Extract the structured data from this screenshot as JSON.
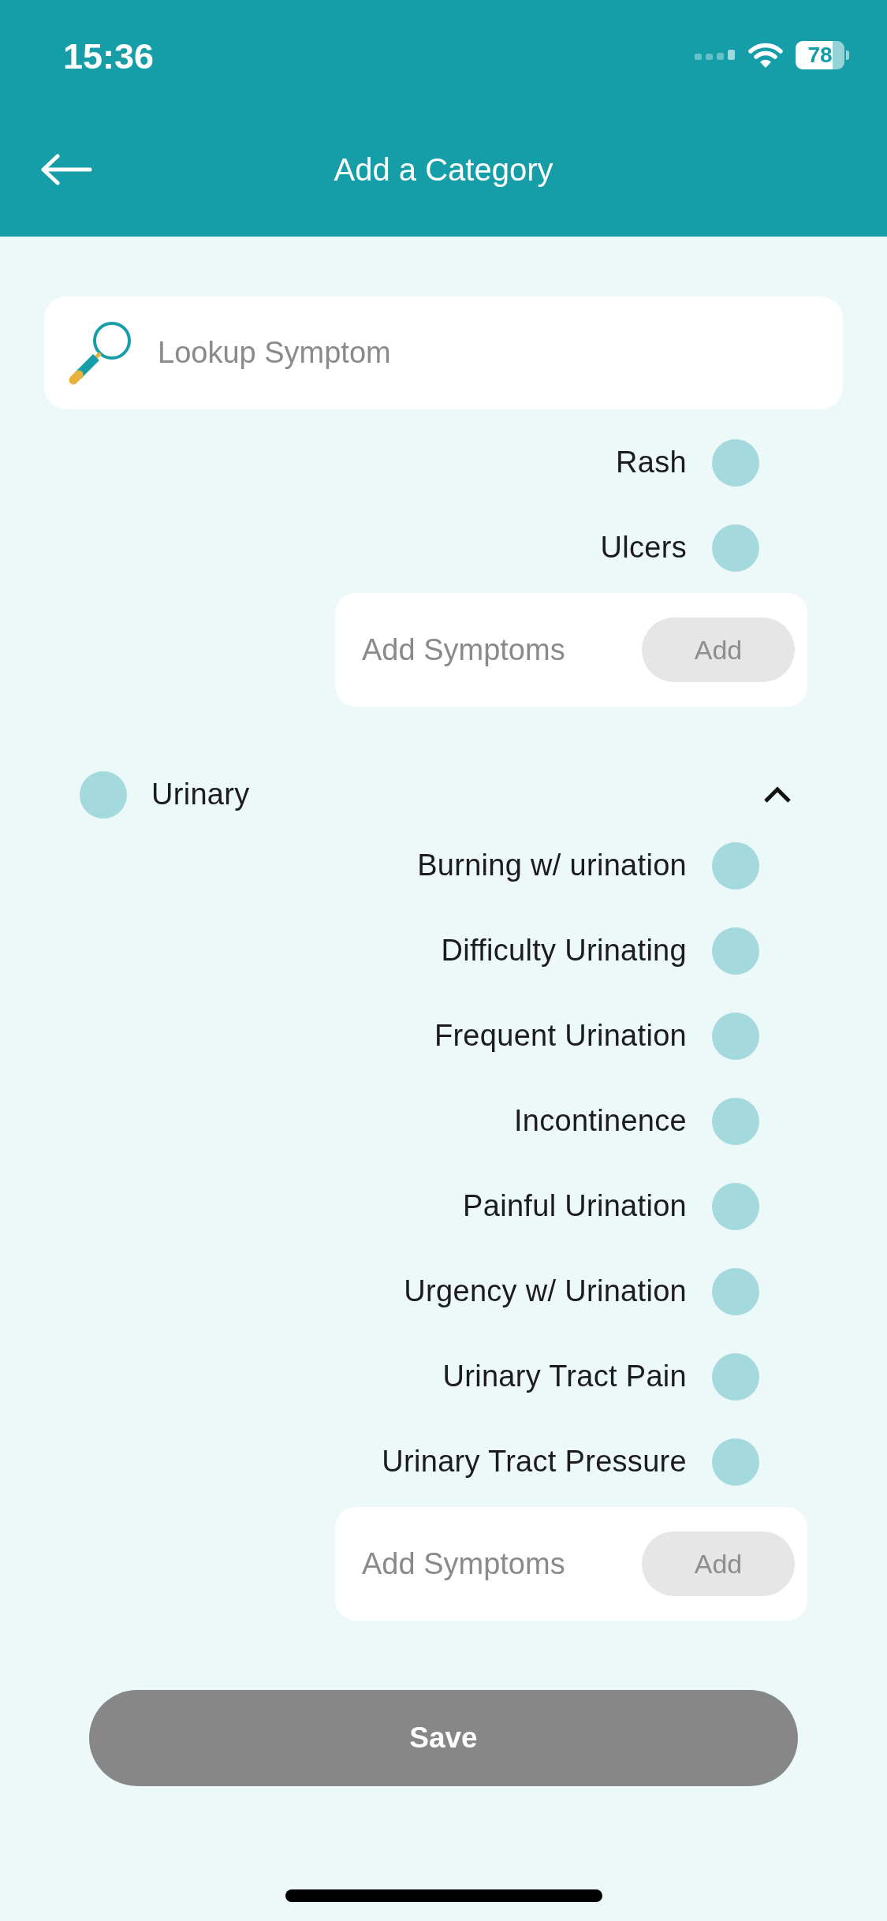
{
  "status_bar": {
    "time": "15:36",
    "battery": "78"
  },
  "header": {
    "title": "Add a Category"
  },
  "search": {
    "placeholder": "Lookup Symptom"
  },
  "categories": [
    {
      "symptoms": [
        {
          "name": "Rash",
          "selected": false
        },
        {
          "name": "Ulcers",
          "selected": false
        }
      ],
      "add_symptom": {
        "placeholder": "Add Symptoms",
        "button": "Add",
        "disabled": true
      }
    },
    {
      "name": "Urinary",
      "selected": false,
      "expanded": true,
      "symptoms": [
        {
          "name": "Burning w/ urination",
          "selected": false
        },
        {
          "name": "Difficulty Urinating",
          "selected": false
        },
        {
          "name": "Frequent Urination",
          "selected": false
        },
        {
          "name": "Incontinence",
          "selected": false
        },
        {
          "name": "Painful Urination",
          "selected": false
        },
        {
          "name": "Urgency w/ Urination",
          "selected": false
        },
        {
          "name": "Urinary Tract Pain",
          "selected": false
        },
        {
          "name": "Urinary Tract Pressure",
          "selected": false
        }
      ],
      "add_symptom": {
        "placeholder": "Add Symptoms",
        "button": "Add",
        "disabled": true
      }
    }
  ],
  "save_button": {
    "label": "Save",
    "disabled": true
  }
}
